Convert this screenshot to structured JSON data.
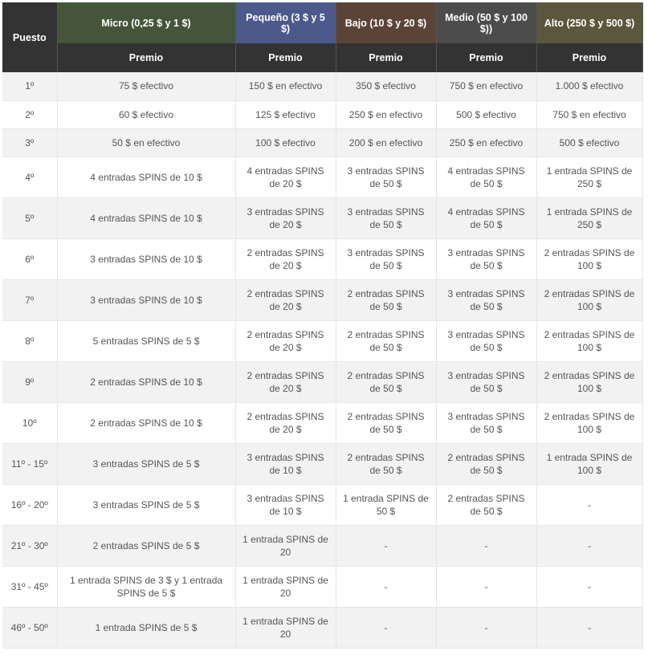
{
  "header": {
    "puesto": "Puesto",
    "tiers": [
      {
        "label": "Micro (0,25 $ y 1 $)",
        "color": "#445539"
      },
      {
        "label": "Pequeño (3 $ y 5 $)",
        "color": "#4c5a8b"
      },
      {
        "label": "Bajo (10 $ y 20 $)",
        "color": "#5b4436"
      },
      {
        "label": "Medio (50 $ y 100 $))",
        "color": "#4c4c4c"
      },
      {
        "label": "Alto (250 $ y 500 $)",
        "color": "#5a573c"
      }
    ],
    "sub": [
      "Premio",
      "Premio",
      "Premio",
      "Premio",
      "Premio"
    ]
  },
  "rows": [
    {
      "pos": "1º",
      "cells": [
        "75 $ efectivo",
        "150 $ en efectivo",
        "350 $ efectivo",
        "750 $ en efectivo",
        "1.000 $ efectivo"
      ]
    },
    {
      "pos": "2º",
      "cells": [
        "60 $ efectivo",
        "125 $ efectivo",
        "250 $ en efectivo",
        "500 $ efectivo",
        "750 $ en efectivo"
      ]
    },
    {
      "pos": "3º",
      "cells": [
        "50 $ en efectivo",
        "100 $ efectivo",
        "200 $ en efectivo",
        "250 $ en efectivo",
        "500 $ efectivo"
      ]
    },
    {
      "pos": "4º",
      "cells": [
        "4 entradas SPINS de 10 $",
        "4 entradas SPINS de 20 $",
        "3 entradas SPINS de 50 $",
        "4 entradas SPINS de 50 $",
        "1 entrada SPINS de 250 $"
      ]
    },
    {
      "pos": "5º",
      "cells": [
        "4 entradas SPINS de 10 $",
        "3 entradas SPINS de 20 $",
        "3 entradas SPINS de 50 $",
        "4 entradas SPINS de 50 $",
        "1 entrada SPINS de 250 $"
      ]
    },
    {
      "pos": "6º",
      "cells": [
        "3 entradas SPINS de 10 $",
        "2 entradas SPINS de 20 $",
        "3 entradas SPINS de 50 $",
        "3 entradas SPINS de 50 $",
        "2 entradas SPINS de 100 $"
      ]
    },
    {
      "pos": "7º",
      "cells": [
        "3 entradas SPINS de 10 $",
        "2 entradas SPINS de 20 $",
        "2 entradas SPINS de 50 $",
        "3 entradas SPINS de 50 $",
        "2 entradas SPINS de 100 $"
      ]
    },
    {
      "pos": "8º",
      "cells": [
        "5 entradas SPINS de 5 $",
        "2 entradas SPINS de 20 $",
        "2 entradas SPINS de 50 $",
        "3 entradas SPINS de 50 $",
        "2 entradas SPINS de 100 $"
      ]
    },
    {
      "pos": "9º",
      "cells": [
        "2 entradas SPINS de 10 $",
        "2 entradas SPINS de 20 $",
        "2 entradas SPINS de 50 $",
        "3 entradas SPINS de 50 $",
        "2 entradas SPINS de 100 $"
      ]
    },
    {
      "pos": "10º",
      "cells": [
        "2 entradas SPINS de 10 $",
        "2 entradas SPINS de 20 $",
        "2 entradas SPINS de 50 $",
        "3 entradas SPINS de 50 $",
        "2 entradas SPINS de 100 $"
      ]
    },
    {
      "pos": "11º - 15º",
      "cells": [
        "3 entradas SPINS de 5 $",
        "3 entradas SPINS de 10 $",
        "2 entradas SPINS de 50 $",
        "2 entradas SPINS de 50 $",
        "1 entrada SPINS de 100 $"
      ]
    },
    {
      "pos": "16º - 20º",
      "cells": [
        "3 entradas SPINS de 5 $",
        "3 entradas SPINS de 10 $",
        "1 entrada SPINS de 50 $",
        "2 entradas SPINS de 50 $",
        "-"
      ]
    },
    {
      "pos": "21º - 30º",
      "cells": [
        "2 entradas SPINS de 5 $",
        "1 entrada SPINS de 20",
        "-",
        "-",
        "-"
      ]
    },
    {
      "pos": "31º - 45º",
      "cells": [
        "1 entrada SPINS de 3 $ y 1 entrada SPINS de 5 $",
        "1 entrada SPINS de 20",
        "-",
        "-",
        "-"
      ]
    },
    {
      "pos": "46º - 50º",
      "cells": [
        "1 entrada SPINS de 5 $",
        "1 entrada SPINS de 20",
        "-",
        "-",
        "-"
      ]
    }
  ]
}
